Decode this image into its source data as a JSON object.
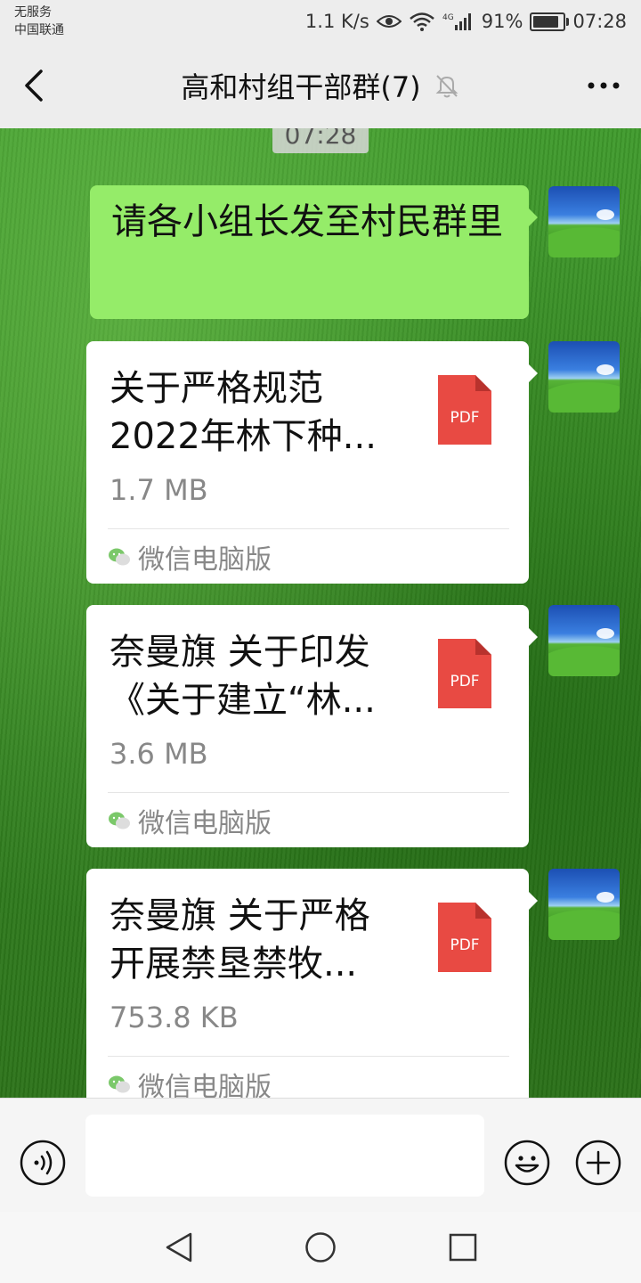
{
  "status_bar": {
    "carrier_line1": "无服务",
    "carrier_line2": "中国联通",
    "net_speed": "1.1 K/s",
    "battery": "91%",
    "time": "07:28"
  },
  "header": {
    "title": "高和村组干部群(7)",
    "back_icon": "chevron-left-icon",
    "mute_icon": "bell-muted-icon",
    "more_icon": "more-dots-icon"
  },
  "chat": {
    "timestamp": "07:28",
    "text_message": "请各小组长发至村民群里",
    "files": [
      {
        "name": "关于严格规范2022年林下种...",
        "size": "1.7 MB",
        "type": "PDF",
        "source": "微信电脑版"
      },
      {
        "name": "奈曼旗 关于印发《关于建立“林...",
        "size": "3.6 MB",
        "type": "PDF",
        "source": "微信电脑版"
      },
      {
        "name": "奈曼旗 关于严格开展禁垦禁牧...",
        "size": "753.8 KB",
        "type": "PDF",
        "source": "微信电脑版"
      }
    ]
  },
  "input_bar": {
    "input_value": "",
    "voice_icon": "voice-icon",
    "emoji_icon": "emoji-icon",
    "plus_icon": "plus-icon"
  },
  "nav_bar": {
    "back_icon": "nav-back-icon",
    "home_icon": "nav-home-icon",
    "recent_icon": "nav-recent-icon"
  },
  "colors": {
    "my_bubble": "#95ec69",
    "pdf_red": "#e84a43",
    "bar_bg": "#ededed"
  }
}
